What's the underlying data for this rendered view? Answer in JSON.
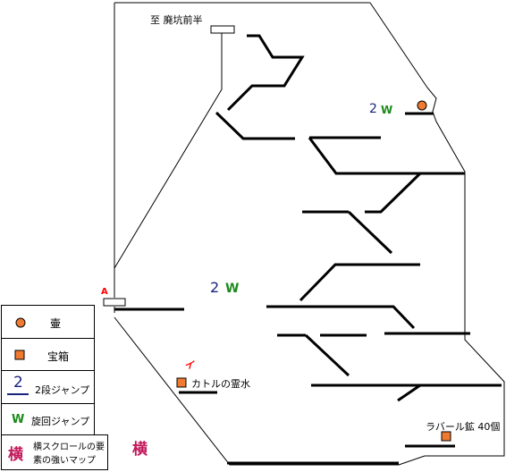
{
  "map": {
    "exit_label": "至 廃坑前半",
    "marker_a": "A",
    "marker_i": "イ",
    "upper_jump": {
      "number": "2",
      "letter": "W"
    },
    "middle_jump": {
      "number": "2",
      "letter": "W"
    },
    "chest_kataru": "カトルの霊水",
    "chest_rabarl": "ラバール鉱 40個",
    "scroll_kanji": "横"
  },
  "legend": {
    "pot": "壷",
    "chest": "宝箱",
    "jump2_symbol": "2",
    "jump2": "2段ジャンプ",
    "spin_symbol": "W",
    "spin": "旋回ジャンプ",
    "scroll_symbol": "横",
    "scroll_line1": "横スクロールの要",
    "scroll_line2": "素の強いマップ"
  },
  "colors": {
    "pot": "#f07a30",
    "chest": "#f07a30",
    "jump_number": "#1a237e",
    "spin_letter": "#1b8a1b",
    "marker": "#ff0000",
    "scroll_kanji": "#c2185b"
  }
}
